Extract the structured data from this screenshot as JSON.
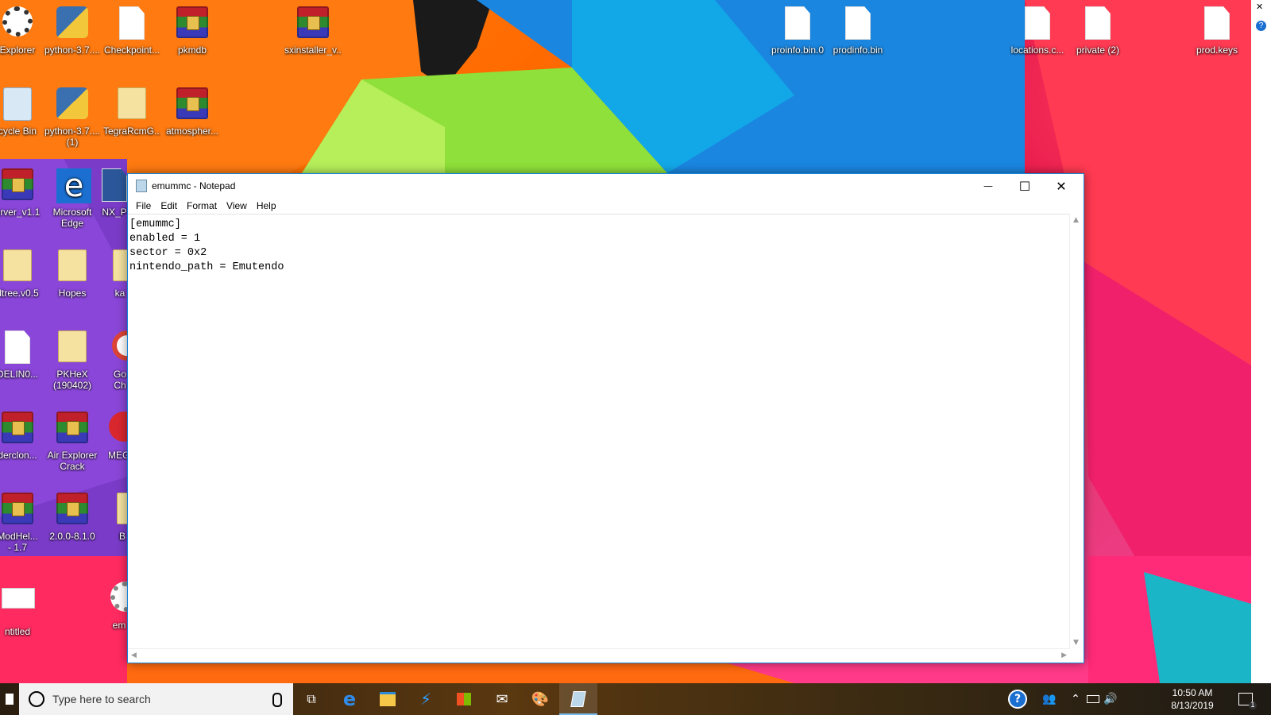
{
  "desktop": {
    "icons": [
      {
        "label": "Explorer",
        "kind": "gear"
      },
      {
        "label": "python-3.7....",
        "kind": "py"
      },
      {
        "label": "Checkpoint...",
        "kind": "file"
      },
      {
        "label": "pkmdb",
        "kind": "rar"
      },
      {
        "label": "sxinstaller_v...",
        "kind": "rar"
      },
      {
        "label": "proinfo.bin.0",
        "kind": "file"
      },
      {
        "label": "prodinfo.bin",
        "kind": "file"
      },
      {
        "label": "locations.c...",
        "kind": "file"
      },
      {
        "label": "private (2)",
        "kind": "file"
      },
      {
        "label": "prod.keys",
        "kind": "file"
      },
      {
        "label": "cycle Bin",
        "kind": "bin"
      },
      {
        "label": "python-3.7....",
        "label2": "(1)",
        "kind": "py"
      },
      {
        "label": "TegraRcmG...",
        "kind": "folder"
      },
      {
        "label": "atmospher...",
        "kind": "rar"
      },
      {
        "label": "erver_v1.1",
        "kind": "rar"
      },
      {
        "label": "Microsoft",
        "label2": "Edge",
        "kind": "edge"
      },
      {
        "label": "NX_P",
        "kind": "word"
      },
      {
        "label": "dtree.v0.5",
        "kind": "folder"
      },
      {
        "label": "Hopes",
        "kind": "folder"
      },
      {
        "label": "ka",
        "kind": "folder"
      },
      {
        "label": "DELIN0...",
        "kind": "file"
      },
      {
        "label": "PKHeX",
        "label2": "(190402)",
        "kind": "folder"
      },
      {
        "label": "Go",
        "label2": "Ch",
        "kind": "chrome"
      },
      {
        "label": "derclon...",
        "kind": "rar"
      },
      {
        "label": "Air Explorer",
        "label2": "Crack",
        "kind": "rar"
      },
      {
        "label": "MEG",
        "kind": "mega"
      },
      {
        "label": "ModHel...",
        "label2": "- 1.7",
        "kind": "rar"
      },
      {
        "label": "2.0.0-8.1.0",
        "kind": "rar"
      },
      {
        "label": "B",
        "kind": "folder"
      },
      {
        "label": "ntitled",
        "kind": "blank"
      },
      {
        "label": "em",
        "kind": "gear"
      }
    ]
  },
  "notepad": {
    "title": "emummc - Notepad",
    "menu": [
      "File",
      "Edit",
      "Format",
      "View",
      "Help"
    ],
    "content": "[emummc]\nenabled = 1\nsector = 0x2\nnintendo_path = Emutendo",
    "caption": {
      "minimize": "—",
      "maximize": "☐",
      "close": "✕"
    }
  },
  "taskbar": {
    "search_placeholder": "Type here to search",
    "clock_time": "10:50 AM",
    "clock_date": "8/13/2019",
    "notification_count": "1",
    "apps": [
      "task-view",
      "edge",
      "file-explorer",
      "visual-studio-code",
      "store",
      "mail",
      "paint",
      "notepad"
    ]
  },
  "colors": {
    "window_border": "#1883d7",
    "taskbar_active": "#76b9ed"
  }
}
